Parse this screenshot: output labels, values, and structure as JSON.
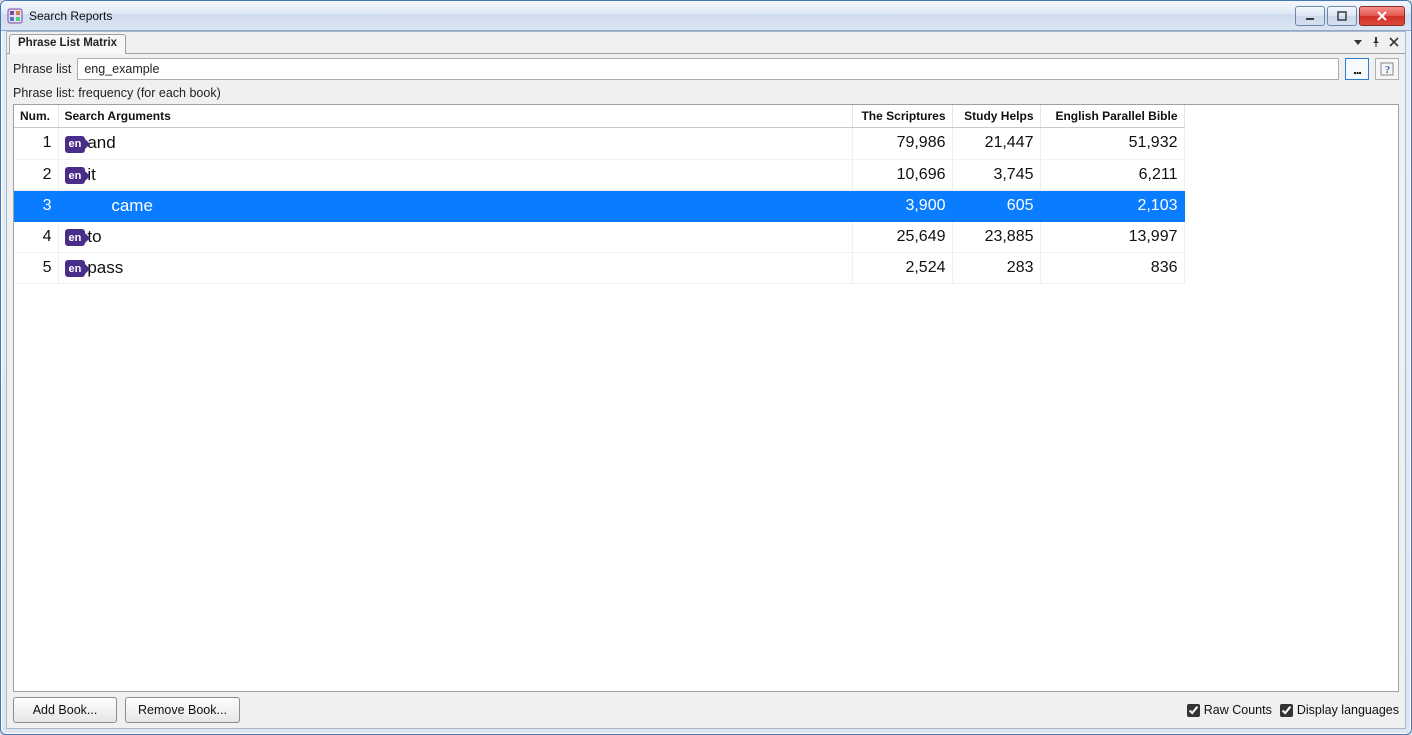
{
  "window": {
    "title": "Search Reports"
  },
  "tab": {
    "label": "Phrase List Matrix"
  },
  "tabmenu": {
    "dropdown": "▼",
    "pin": "📌",
    "close": "×"
  },
  "phrase": {
    "label": "Phrase list",
    "value": "eng_example",
    "browse_label": "...",
    "help_label": "?"
  },
  "caption": "Phrase list: frequency (for each book)",
  "columns": {
    "num": "Num.",
    "args": "Search Arguments",
    "b": "The Scriptures",
    "c": "Study Helps",
    "d": "English Parallel Bible"
  },
  "lang_badge": "en",
  "rows": [
    {
      "num": "1",
      "arg": "and",
      "b": "79,986",
      "c": "21,447",
      "d": "51,932",
      "sel": false,
      "show_badge": true
    },
    {
      "num": "2",
      "arg": "it",
      "b": "10,696",
      "c": "3,745",
      "d": "6,211",
      "sel": false,
      "show_badge": true
    },
    {
      "num": "3",
      "arg": "came",
      "b": "3,900",
      "c": "605",
      "d": "2,103",
      "sel": true,
      "show_badge": false
    },
    {
      "num": "4",
      "arg": "to",
      "b": "25,649",
      "c": "23,885",
      "d": "13,997",
      "sel": false,
      "show_badge": true
    },
    {
      "num": "5",
      "arg": "pass",
      "b": "2,524",
      "c": "283",
      "d": "836",
      "sel": false,
      "show_badge": true
    }
  ],
  "footer": {
    "add_book": "Add Book...",
    "remove_book": "Remove Book...",
    "raw_counts": "Raw Counts",
    "display_langs": "Display languages",
    "raw_counts_checked": true,
    "display_langs_checked": true
  }
}
